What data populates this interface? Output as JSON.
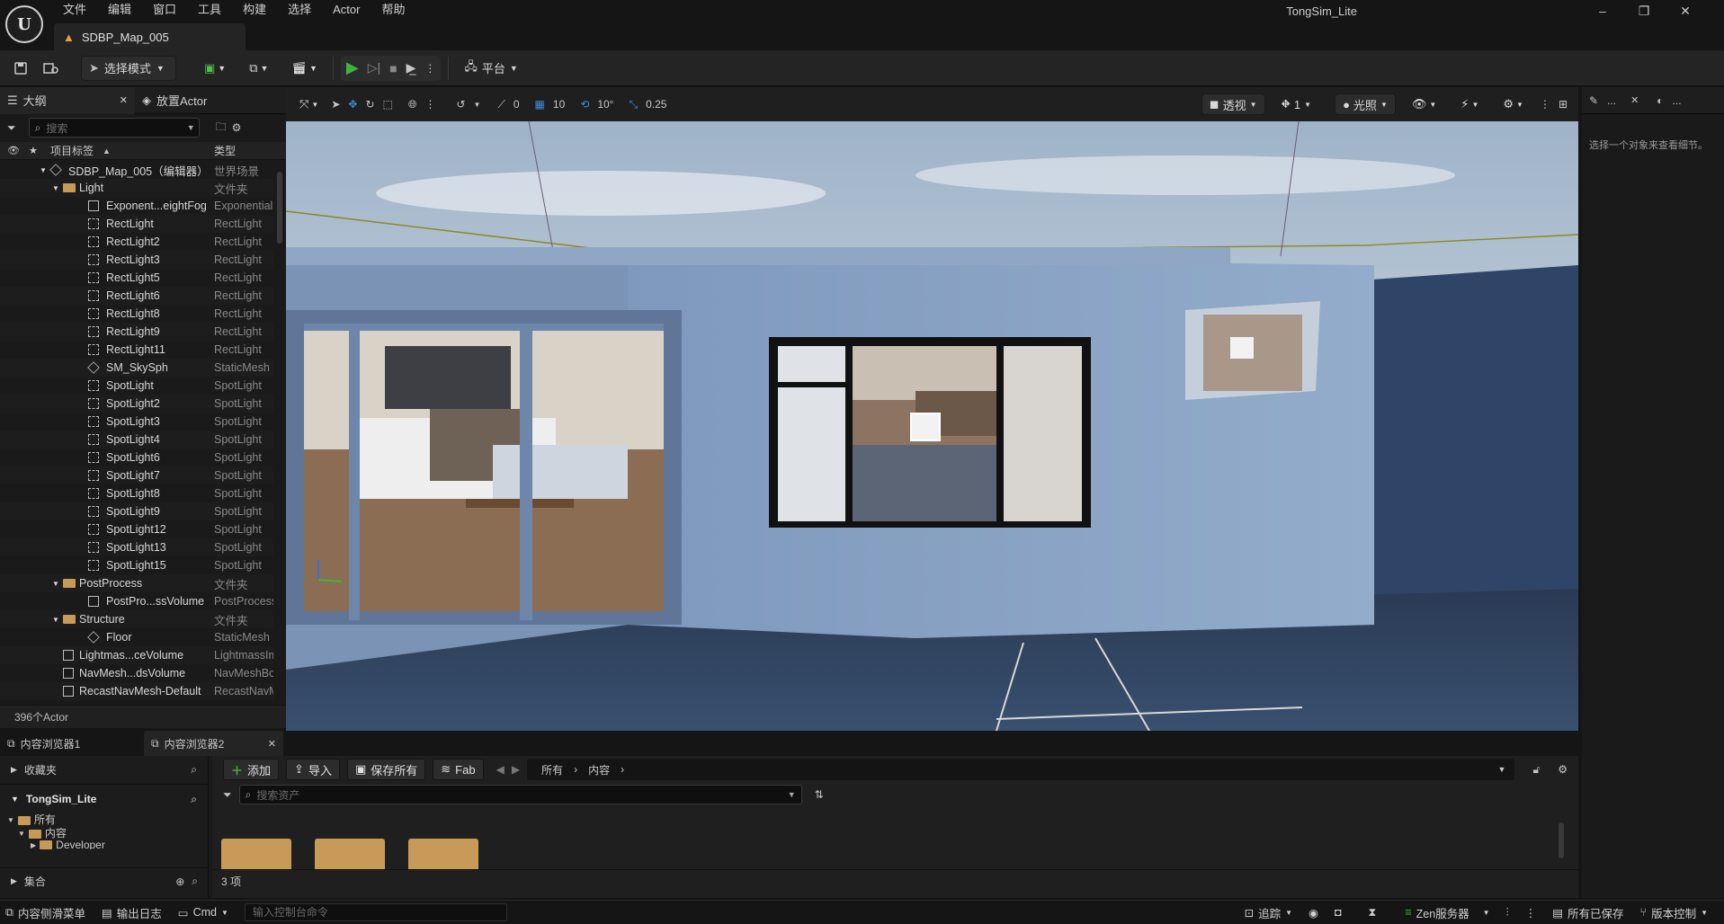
{
  "app": {
    "logo_text": "U",
    "menu": [
      "文件",
      "编辑",
      "窗口",
      "工具",
      "构建",
      "选择",
      "Actor",
      "帮助"
    ],
    "document_tab": "SDBP_Map_005",
    "project_name": "TongSim_Lite"
  },
  "toolbar": {
    "select_mode_label": "选择模式",
    "platform_label": "平台"
  },
  "outliner": {
    "tab_label": "大纲",
    "place_actor_tab": "放置Actor",
    "search_placeholder": "搜索",
    "col_label": "项目标签",
    "col_type": "类型",
    "rows": [
      {
        "label": "SDBP_Map_005（编辑器）",
        "type": "世界场景",
        "indent": 0,
        "icon": "world"
      },
      {
        "label": "Light",
        "type": "文件夹",
        "indent": 1,
        "icon": "folder"
      },
      {
        "label": "Exponent...eightFog",
        "type": "ExponentialHeightFog",
        "indent": 2,
        "icon": "fog"
      },
      {
        "label": "RectLight",
        "type": "RectLight",
        "indent": 2,
        "icon": "light"
      },
      {
        "label": "RectLight2",
        "type": "RectLight",
        "indent": 2,
        "icon": "light"
      },
      {
        "label": "RectLight3",
        "type": "RectLight",
        "indent": 2,
        "icon": "light"
      },
      {
        "label": "RectLight5",
        "type": "RectLight",
        "indent": 2,
        "icon": "light"
      },
      {
        "label": "RectLight6",
        "type": "RectLight",
        "indent": 2,
        "icon": "light"
      },
      {
        "label": "RectLight8",
        "type": "RectLight",
        "indent": 2,
        "icon": "light"
      },
      {
        "label": "RectLight9",
        "type": "RectLight",
        "indent": 2,
        "icon": "light"
      },
      {
        "label": "RectLight11",
        "type": "RectLight",
        "indent": 2,
        "icon": "light"
      },
      {
        "label": "SM_SkySph",
        "type": "StaticMesh",
        "indent": 2,
        "icon": "mesh"
      },
      {
        "label": "SpotLight",
        "type": "SpotLight",
        "indent": 2,
        "icon": "spot"
      },
      {
        "label": "SpotLight2",
        "type": "SpotLight",
        "indent": 2,
        "icon": "spot"
      },
      {
        "label": "SpotLight3",
        "type": "SpotLight",
        "indent": 2,
        "icon": "spot"
      },
      {
        "label": "SpotLight4",
        "type": "SpotLight",
        "indent": 2,
        "icon": "spot"
      },
      {
        "label": "SpotLight6",
        "type": "SpotLight",
        "indent": 2,
        "icon": "spot"
      },
      {
        "label": "SpotLight7",
        "type": "SpotLight",
        "indent": 2,
        "icon": "spot"
      },
      {
        "label": "SpotLight8",
        "type": "SpotLight",
        "indent": 2,
        "icon": "spot"
      },
      {
        "label": "SpotLight9",
        "type": "SpotLight",
        "indent": 2,
        "icon": "spot"
      },
      {
        "label": "SpotLight12",
        "type": "SpotLight",
        "indent": 2,
        "icon": "spot"
      },
      {
        "label": "SpotLight13",
        "type": "SpotLight",
        "indent": 2,
        "icon": "spot"
      },
      {
        "label": "SpotLight15",
        "type": "SpotLight",
        "indent": 2,
        "icon": "spot"
      },
      {
        "label": "PostProcess",
        "type": "文件夹",
        "indent": 1,
        "icon": "folder"
      },
      {
        "label": "PostPro...ssVolume",
        "type": "PostProcessVolume",
        "indent": 2,
        "icon": "volume"
      },
      {
        "label": "Structure",
        "type": "文件夹",
        "indent": 1,
        "icon": "folder"
      },
      {
        "label": "Floor",
        "type": "StaticMesh",
        "indent": 2,
        "icon": "mesh"
      },
      {
        "label": "Lightmas...ceVolume",
        "type": "LightmassImportanceVolume",
        "indent": 1,
        "icon": "volume"
      },
      {
        "label": "NavMesh...dsVolume",
        "type": "NavMeshBoundsVolume",
        "indent": 1,
        "icon": "volume"
      },
      {
        "label": "RecastNavMesh-Default",
        "type": "RecastNavMesh",
        "indent": 1,
        "icon": "volume"
      }
    ],
    "actor_count": "396个Actor"
  },
  "viewport": {
    "snap_translate": "10",
    "snap_rotate": "10°",
    "snap_scale": "0.25",
    "angle_value": "0",
    "view_mode_label": "透视",
    "lighting_label": "光照",
    "camera_speed": "1"
  },
  "details": {
    "empty_hint": "选择一个对象来查看细节。",
    "tab_dots": "...",
    "tab_dots2": "..."
  },
  "content_browser": {
    "tab1": "内容浏览器1",
    "tab2": "内容浏览器2",
    "favorites_label": "收藏夹",
    "project_label": "TongSim_Lite",
    "tree_all": "所有",
    "tree_content": "内容",
    "tree_developer": "Developer",
    "collections_label": "集合",
    "add_label": "添加",
    "import_label": "导入",
    "save_all_label": "保存所有",
    "fab_label": "Fab",
    "path_all": "所有",
    "path_content": "内容",
    "search_placeholder": "搜索资产",
    "item_count": "3 项",
    "folders": [
      "",
      "",
      ""
    ]
  },
  "statusbar": {
    "content_drawer": "内容侧滑菜单",
    "output_log": "输出日志",
    "cmd_label": "Cmd",
    "cmd_placeholder": "输入控制台命令",
    "trace_label": "追踪",
    "zen_label": "Zen服务器",
    "all_saved": "所有已保存",
    "source_control": "版本控制"
  },
  "colors": {
    "accent_play": "#3fb43f",
    "accent_blue": "#3a8fe0",
    "folder": "#c79b57"
  }
}
